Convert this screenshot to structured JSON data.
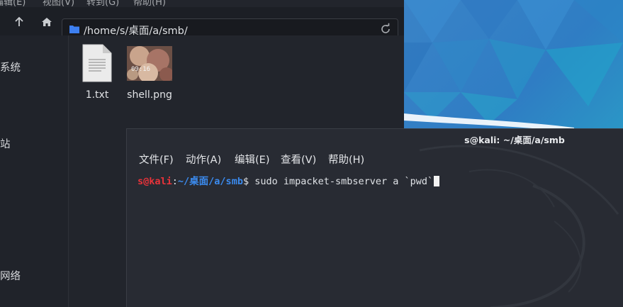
{
  "file_manager": {
    "menu": [
      "编辑(E)",
      "视图(V)",
      "转到(G)",
      "帮助(H)"
    ],
    "toolbar": {
      "up_icon": "arrow-up-icon",
      "home_icon": "home-icon",
      "path": "/home/s/桌面/a/smb/",
      "folder_icon": "folder-icon",
      "refresh_icon": "refresh-icon"
    },
    "sidebar": [
      "系统",
      "站",
      "网络"
    ],
    "files": [
      {
        "name": "1.txt",
        "icon": "text-file-icon"
      },
      {
        "name": "shell.png",
        "icon": "image-thumbnail",
        "thumbnail_text": "09:16"
      }
    ]
  },
  "terminal": {
    "title": "s@kali: ~/桌面/a/smb",
    "menu": [
      "文件(F)",
      "动作(A)",
      "编辑(E)",
      "查看(V)",
      "帮助(H)"
    ],
    "prompt_user": "s@kali",
    "prompt_sep": ":",
    "prompt_path": "~/桌面/a/smb",
    "prompt_symbol": "$",
    "command": " sudo impacket-smbserver a `pwd`"
  },
  "colors": {
    "prompt_user": "#e8333a",
    "prompt_path": "#3b8bef",
    "folder_accent": "#3d7ff0",
    "desktop_blue": "#2f7dc4"
  }
}
